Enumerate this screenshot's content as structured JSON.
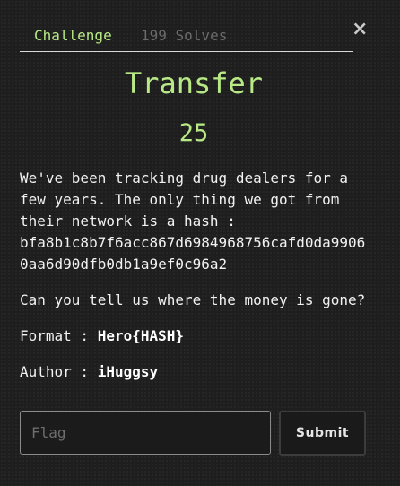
{
  "modal": {
    "close_label": "×",
    "tabs": [
      {
        "label": "Challenge",
        "active": true
      },
      {
        "label": "199 Solves",
        "active": false
      }
    ],
    "title": "Transfer",
    "points": "25",
    "description_lines": [
      "We've been tracking drug dealers for a",
      "few years. The only thing we got from",
      "their network is a hash :",
      "bfa8b1c8b7f6acc867d6984968756cafd0da9906",
      "0aa6d90dfb0db1a9ef0c96a2"
    ],
    "question": "Can you tell us where the money is gone?",
    "format_label": "Format : ",
    "format_value": "Hero{HASH}",
    "author_label": "Author : ",
    "author_value": "iHuggsy",
    "flag_input": {
      "placeholder": "Flag",
      "value": ""
    },
    "submit_label": "Submit"
  },
  "colors": {
    "accent": "#b8e986",
    "background": "#1d1e1d",
    "muted_tab": "#6b6b6b"
  }
}
